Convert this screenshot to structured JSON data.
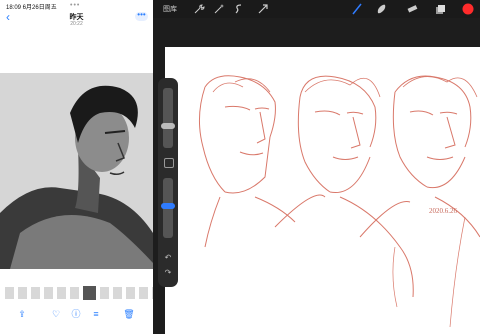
{
  "photos": {
    "status_time": "18:09  6月26日周五",
    "dots": "•••",
    "back": "‹",
    "title": "昨天",
    "subtitle": "20:22",
    "more": "•••",
    "toolbar": [
      {
        "name": "share-icon",
        "glyph": "⇪"
      },
      {
        "name": "heart-icon",
        "glyph": "♡"
      },
      {
        "name": "info-icon",
        "glyph": "ⓘ"
      },
      {
        "name": "adjust-icon",
        "glyph": "≡"
      },
      {
        "name": "trash-icon",
        "glyph": "🗑"
      }
    ]
  },
  "procreate": {
    "gallery": "图库",
    "tools_left": [
      "wrench-icon",
      "magic-wand-icon",
      "selection-icon",
      "transform-icon"
    ],
    "tools_right": [
      "brush-icon",
      "smudge-icon",
      "eraser-icon",
      "layers-icon",
      "color-swatch"
    ],
    "accent": "#2f7cff",
    "color": "#ff2b2b",
    "signature": "2020.6.26"
  }
}
